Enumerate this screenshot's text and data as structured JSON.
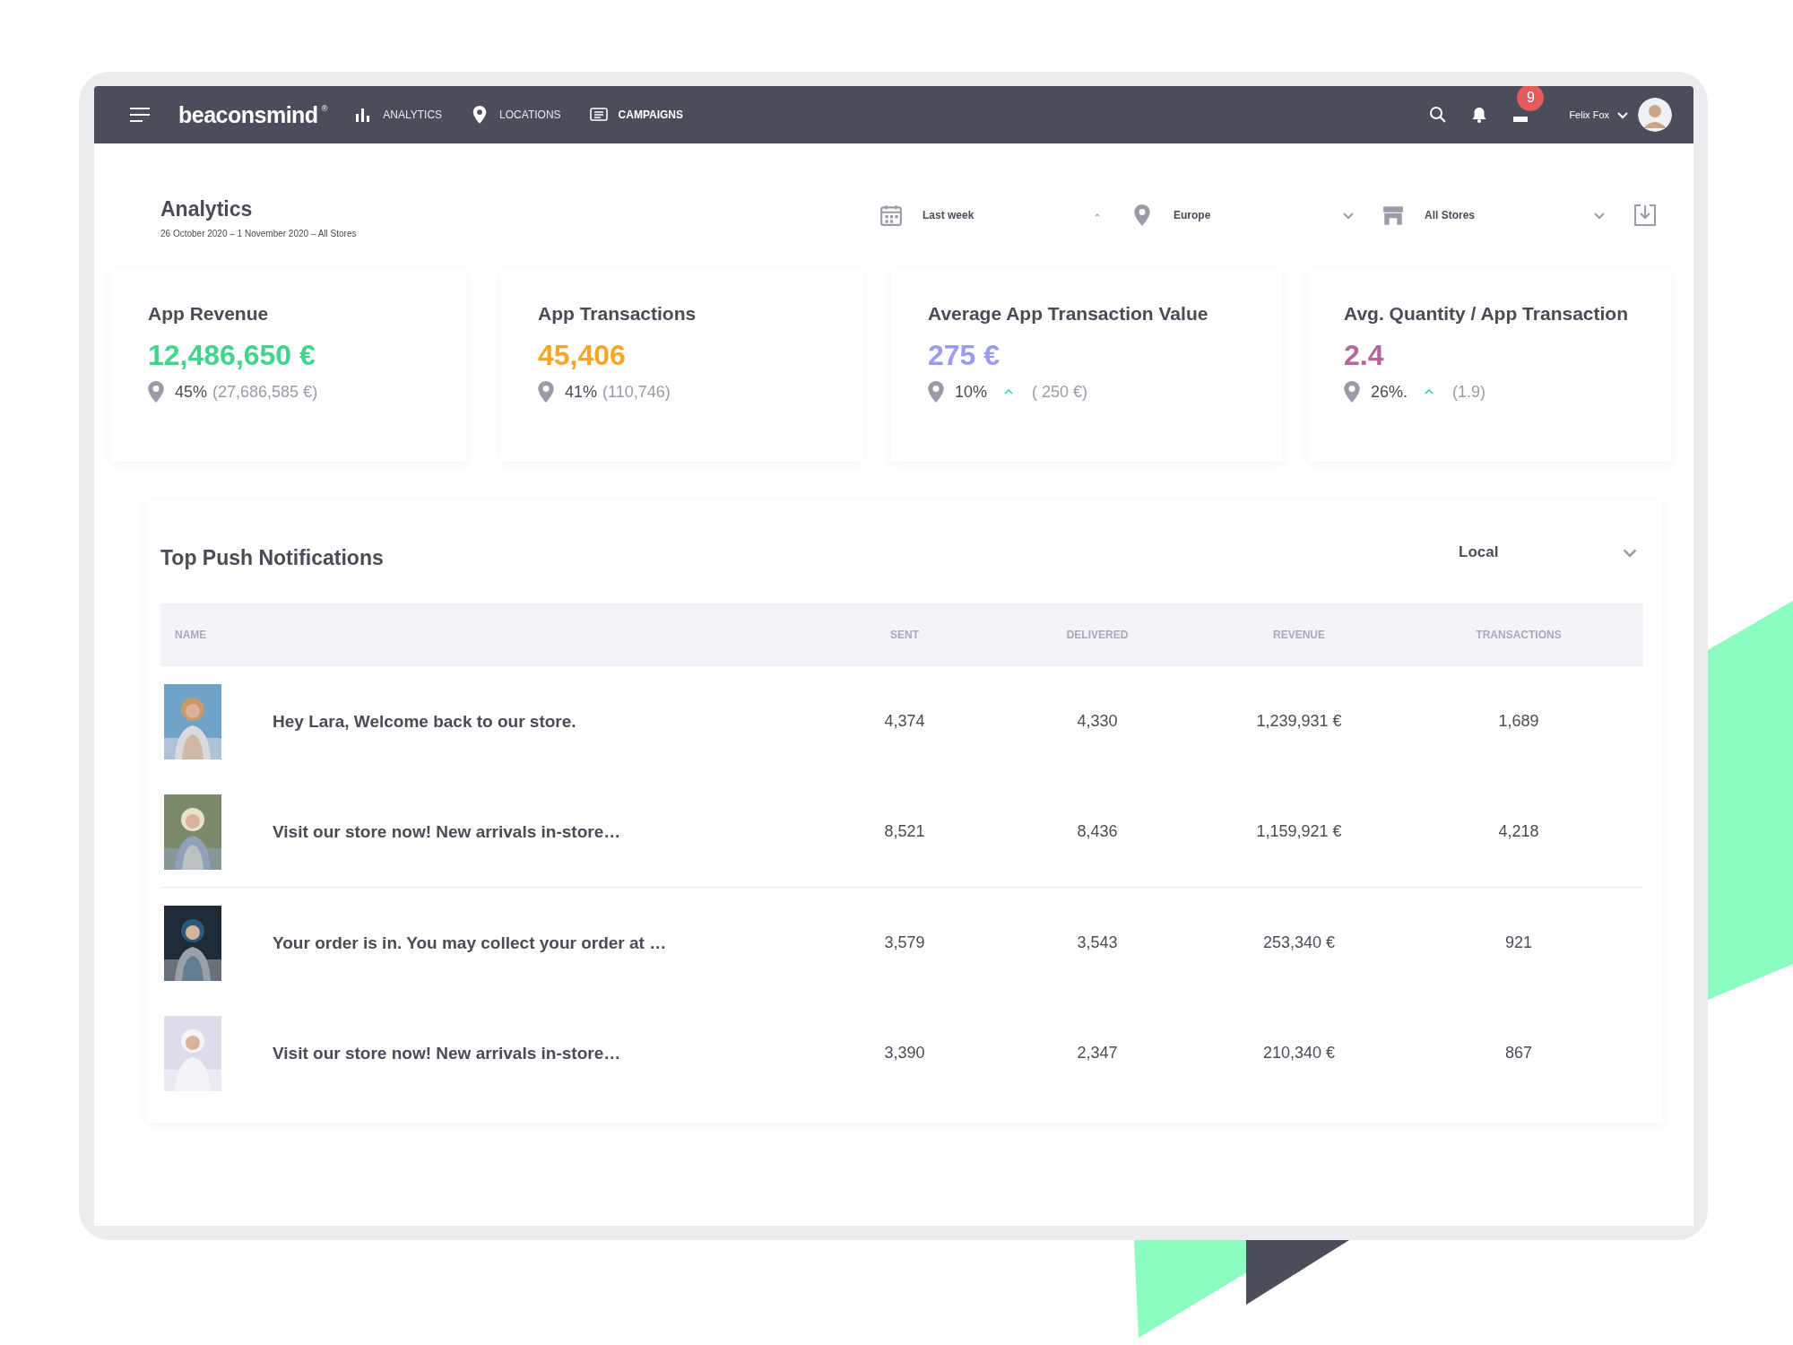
{
  "navbar": {
    "brand": "beaconsmind",
    "brand_mark": "®",
    "items": [
      {
        "label": "ANALYTICS",
        "kind": "chart",
        "selected": false
      },
      {
        "label": "LOCATIONS",
        "kind": "pin",
        "selected": false
      },
      {
        "label": "CAMPAIGNS",
        "kind": "list",
        "selected": true
      }
    ],
    "notification_count": "9",
    "user": "Felix Fox"
  },
  "header": {
    "title": "Analytics",
    "subtitle": "26 October 2020 – 1 November 2020 – All Stores",
    "filters": [
      {
        "kind": "calendar",
        "label": "Last week",
        "expanded": true
      },
      {
        "kind": "pin",
        "label": "Europe",
        "expanded": false
      },
      {
        "kind": "store",
        "label": "All Stores",
        "expanded": false
      }
    ]
  },
  "kpis": [
    {
      "title": "App Revenue",
      "value": "12,486,650 €",
      "color": "#3fd68c",
      "change": "45%",
      "trending_up": false,
      "compare": "(27,686,585 €)"
    },
    {
      "title": "App Transactions",
      "value": "45,406",
      "color": "#f5a623",
      "change": "41%",
      "trending_up": false,
      "compare": "(110,746)"
    },
    {
      "title": "Average App Transaction Value",
      "value": "275 €",
      "color": "#9a9af0",
      "change": "10%",
      "trending_up": true,
      "compare": "( 250 €)"
    },
    {
      "title": "Avg. Quantity / App Transaction",
      "value": "2.4",
      "color": "#b5679a",
      "change": "26%.",
      "trending_up": true,
      "compare": "(1.9)"
    }
  ],
  "table": {
    "title": "Top Push Notifications",
    "scope": "Local",
    "columns": [
      "NAME",
      "SENT",
      "DELIVERED",
      "REVENUE",
      "TRANSACTIONS"
    ],
    "rows": [
      {
        "name": "Hey Lara, Welcome back to our store.",
        "sent": "4,374",
        "delivered": "4,330",
        "revenue": "1,239,931 €",
        "transactions": "1,689"
      },
      {
        "name": "Visit our store now! New arrivals in-store…",
        "sent": "8,521",
        "delivered": "8,436",
        "revenue": "1,159,921 €",
        "transactions": "4,218"
      },
      {
        "name": "Your order is in. You may collect your order at …",
        "sent": "3,579",
        "delivered": "3,543",
        "revenue": "253,340 €",
        "transactions": "921"
      },
      {
        "name": "Visit our store now! New arrivals in-store…",
        "sent": "3,390",
        "delivered": "2,347",
        "revenue": "210,340 €",
        "transactions": "867"
      }
    ]
  }
}
